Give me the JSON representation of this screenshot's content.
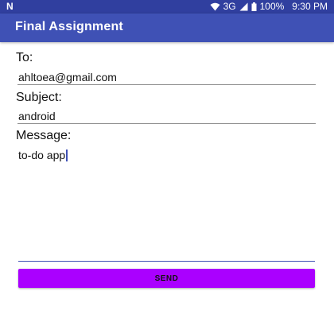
{
  "status_bar": {
    "left_icon": "n-notification-icon",
    "network": "3G",
    "battery": "100%",
    "time": "9:30 PM",
    "icons": [
      "wifi-icon",
      "signal-icon",
      "battery-icon"
    ]
  },
  "app_bar": {
    "title": "Final Assignment"
  },
  "form": {
    "to_label": "To:",
    "to_value": "ahltoea@gmail.com",
    "subject_label": "Subject:",
    "subject_value": "android",
    "message_label": "Message:",
    "message_value": "to-do app",
    "send_label": "SEND"
  },
  "colors": {
    "status_bar": "#303f9f",
    "app_bar": "#3f51b5",
    "send_button": "#aa00ff",
    "accent": "#3f51b5"
  }
}
